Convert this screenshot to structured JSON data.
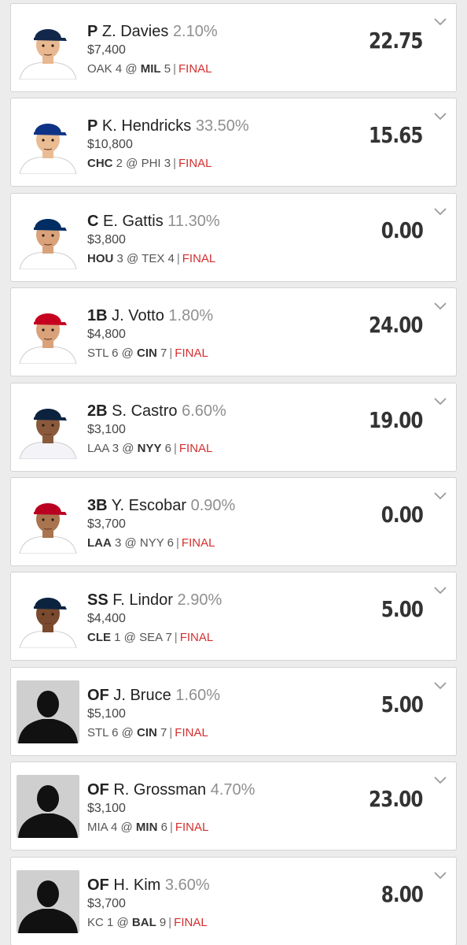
{
  "colors": {
    "final": "#d32f2f",
    "percent": "#8f8f8f",
    "card_bg": "#ffffff",
    "page_bg": "#ececec"
  },
  "players": [
    {
      "position": "P",
      "name": "Z. Davies",
      "ownership": "2.10%",
      "salary": "$7,400",
      "away_team": "OAK",
      "away_score": "4",
      "home_team": "MIL",
      "home_score": "5",
      "bold_side": "home",
      "status": "FINAL",
      "points": "22.75",
      "photo": "player-photo",
      "cap": "#12284b",
      "jersey": "#ffffff",
      "skin": "#e8b890"
    },
    {
      "position": "P",
      "name": "K. Hendricks",
      "ownership": "33.50%",
      "salary": "$10,800",
      "away_team": "CHC",
      "away_score": "2",
      "home_team": "PHI",
      "home_score": "3",
      "bold_side": "away",
      "status": "FINAL",
      "points": "15.65",
      "photo": "player-photo",
      "cap": "#0e3386",
      "jersey": "#ffffff",
      "skin": "#e9bc94"
    },
    {
      "position": "C",
      "name": "E. Gattis",
      "ownership": "11.30%",
      "salary": "$3,800",
      "away_team": "HOU",
      "away_score": "3",
      "home_team": "TEX",
      "home_score": "4",
      "bold_side": "away",
      "status": "FINAL",
      "points": "0.00",
      "photo": "player-photo",
      "cap": "#002d62",
      "jersey": "#ffffff",
      "skin": "#d9a27a"
    },
    {
      "position": "1B",
      "name": "J. Votto",
      "ownership": "1.80%",
      "salary": "$4,800",
      "away_team": "STL",
      "away_score": "6",
      "home_team": "CIN",
      "home_score": "7",
      "bold_side": "home",
      "status": "FINAL",
      "points": "24.00",
      "photo": "player-photo",
      "cap": "#c6011f",
      "jersey": "#ffffff",
      "skin": "#d9a27a"
    },
    {
      "position": "2B",
      "name": "S. Castro",
      "ownership": "6.60%",
      "salary": "$3,100",
      "away_team": "LAA",
      "away_score": "3",
      "home_team": "NYY",
      "home_score": "6",
      "bold_side": "home",
      "status": "FINAL",
      "points": "19.00",
      "photo": "player-photo",
      "cap": "#0c2340",
      "jersey": "#f4f4f8",
      "skin": "#8a5a3c"
    },
    {
      "position": "3B",
      "name": "Y. Escobar",
      "ownership": "0.90%",
      "salary": "$3,700",
      "away_team": "LAA",
      "away_score": "3",
      "home_team": "NYY",
      "home_score": "6",
      "bold_side": "away",
      "status": "FINAL",
      "points": "0.00",
      "photo": "player-photo",
      "cap": "#ba0021",
      "jersey": "#ffffff",
      "skin": "#a8754f"
    },
    {
      "position": "SS",
      "name": "F. Lindor",
      "ownership": "2.90%",
      "salary": "$4,400",
      "away_team": "CLE",
      "away_score": "1",
      "home_team": "SEA",
      "home_score": "7",
      "bold_side": "away",
      "status": "FINAL",
      "points": "5.00",
      "photo": "player-photo",
      "cap": "#0c2340",
      "jersey": "#ffffff",
      "skin": "#7a4a2e"
    },
    {
      "position": "OF",
      "name": "J. Bruce",
      "ownership": "1.60%",
      "salary": "$5,100",
      "away_team": "STL",
      "away_score": "6",
      "home_team": "CIN",
      "home_score": "7",
      "bold_side": "home",
      "status": "FINAL",
      "points": "5.00",
      "photo": "silhouette-placeholder"
    },
    {
      "position": "OF",
      "name": "R. Grossman",
      "ownership": "4.70%",
      "salary": "$3,100",
      "away_team": "MIA",
      "away_score": "4",
      "home_team": "MIN",
      "home_score": "6",
      "bold_side": "home",
      "status": "FINAL",
      "points": "23.00",
      "photo": "silhouette-placeholder"
    },
    {
      "position": "OF",
      "name": "H. Kim",
      "ownership": "3.60%",
      "salary": "$3,700",
      "away_team": "KC",
      "away_score": "1",
      "home_team": "BAL",
      "home_score": "9",
      "bold_side": "home",
      "status": "FINAL",
      "points": "8.00",
      "photo": "silhouette-placeholder"
    }
  ]
}
